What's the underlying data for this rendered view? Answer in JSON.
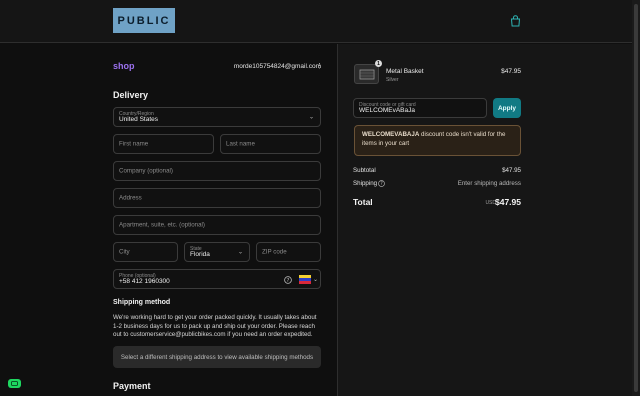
{
  "header": {
    "logo_text": "PUBLIC",
    "cart_icon": "shopping-bag-icon"
  },
  "account": {
    "shop_label": "shop",
    "email": "morde105754824@gmail.com",
    "menu_glyph": "⋮"
  },
  "delivery": {
    "heading": "Delivery",
    "country_label": "Country/Region",
    "country_value": "United States",
    "first_name_ph": "First name",
    "last_name_ph": "Last name",
    "company_ph": "Company (optional)",
    "address_ph": "Address",
    "apartment_ph": "Apartment, suite, etc. (optional)",
    "city_ph": "City",
    "state_label": "State",
    "state_value": "Florida",
    "zip_ph": "ZIP code",
    "phone_label": "Phone (optional)",
    "phone_value": "+58 412 1960300"
  },
  "shipping": {
    "heading": "Shipping method",
    "description": "We're working hard to get your order packed quickly. It usually takes about 1-2 business days for us to pack up and ship out your order. Please reach out to customerservice@publicbikes.com if you need an order expedited.",
    "notice": "Select a different shipping address to view available shipping methods"
  },
  "payment": {
    "heading": "Payment"
  },
  "order": {
    "item_name": "Metal Basket",
    "item_variant": "Silver",
    "item_qty": "1",
    "item_price": "$47.95",
    "discount_label": "Discount code or gift card",
    "discount_value": "WELCOMEvABaJa",
    "apply_label": "Apply",
    "warning_code": "WELCOMEVABAJA",
    "warning_text": " discount code isn't valid for the items in your cart",
    "subtotal_label": "Subtotal",
    "subtotal_value": "$47.95",
    "shipping_label": "Shipping",
    "shipping_value": "Enter shipping address",
    "total_label": "Total",
    "total_currency": "USD",
    "total_value": "$47.95"
  },
  "colors": {
    "accent": "#117a84",
    "shop": "#9c72f0",
    "logo_bg": "#6fa2c6"
  }
}
